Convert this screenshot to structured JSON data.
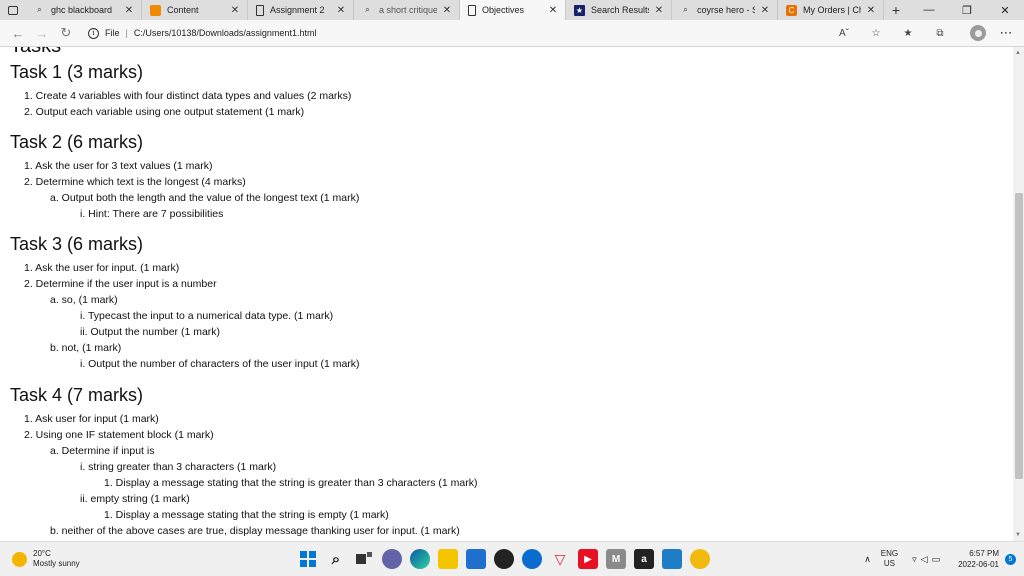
{
  "browser": {
    "tabs": [
      {
        "label": "ghc blackboard",
        "icon": "search-icon"
      },
      {
        "label": "Content",
        "icon": "blackboard-icon"
      },
      {
        "label": "Assignment 2",
        "icon": "document-icon"
      },
      {
        "label": "a short critique o",
        "icon": "search-icon"
      },
      {
        "label": "Objectives",
        "icon": "document-icon",
        "active": true
      },
      {
        "label": "Search Results | C",
        "icon": "star-icon"
      },
      {
        "label": "coyrse hero - Sea",
        "icon": "search-icon"
      },
      {
        "label": "My Orders | Cheg",
        "icon": "chegg-icon"
      }
    ],
    "new_tab_label": "+",
    "url_scheme_label": "File",
    "url": "C:/Users/10138/Downloads/assignment1.html"
  },
  "document": {
    "partial_heading": "Tasks",
    "sections": [
      {
        "title": "Task 1 (3 marks)",
        "items": [
          "1. Create 4 variables with four distinct data types and values (2 marks)",
          "2. Output each variable using one output statement (1 mark)"
        ]
      },
      {
        "title": "Task 2 (6 marks)",
        "items": [
          "1. Ask the user for 3 text values (1 mark)",
          "2. Determine which text is the longest (4 marks)",
          "a. Output both the length and the value of the longest text (1 mark)",
          "i. Hint: There are 7 possibilities"
        ]
      },
      {
        "title": "Task 3 (6 marks)",
        "items": [
          "1. Ask the user for input. (1 mark)",
          "2. Determine if the user input is a number",
          "a. so, (1 mark)",
          "i. Typecast the input to a numerical data type. (1 mark)",
          "ii. Output the number (1 mark)",
          "b. not, (1 mark)",
          "i. Output the number of characters of the user input (1 mark)"
        ]
      },
      {
        "title": "Task 4 (7 marks)",
        "items": [
          "1. Ask user for input (1 mark)",
          "2. Using one IF statement block (1 mark)",
          "a. Determine if input is",
          "i. string greater than 3 characters (1 mark)",
          "1. Display a message stating that the string is greater than 3 characters (1 mark)",
          "ii. empty string (1 mark)",
          "1. Display a message stating that the string is empty (1 mark)",
          "b. neither of the above cases are true, display message thanking user for input. (1 mark)"
        ]
      }
    ]
  },
  "taskbar": {
    "weather_temp": "20°C",
    "weather_desc": "Mostly sunny",
    "lang_top": "ENG",
    "lang_bottom": "US",
    "time": "6:57 PM",
    "date": "2022-06-01",
    "notification_count": "5",
    "mail_letter": "M",
    "amazon_letter": "a"
  },
  "colors": {
    "accent": "#0078d4",
    "tab_bar": "#dedede",
    "active_tab": "#f7f7f7"
  }
}
